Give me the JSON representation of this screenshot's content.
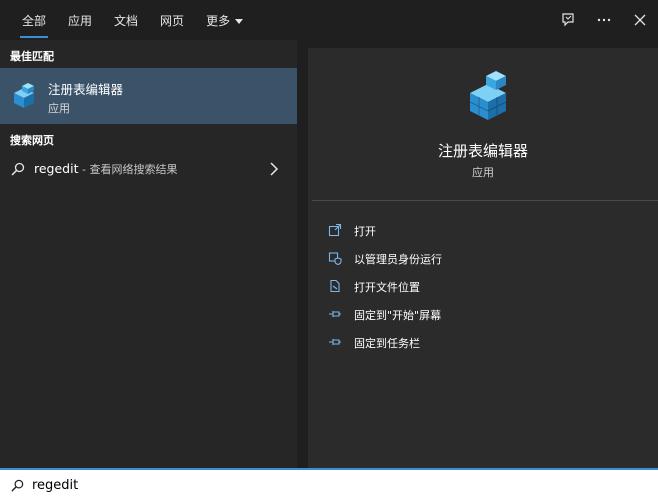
{
  "tabs": [
    {
      "label": "全部",
      "active": true
    },
    {
      "label": "应用"
    },
    {
      "label": "文档"
    },
    {
      "label": "网页"
    },
    {
      "label": "更多"
    }
  ],
  "top_icons": [
    "feedback-icon",
    "more-icon",
    "close-icon"
  ],
  "left": {
    "best_match_title": "最佳匹配",
    "best_match": {
      "name": "注册表编辑器",
      "type": "应用",
      "icon": "registry-editor-icon"
    },
    "web_title": "搜索网页",
    "web_item": {
      "query": "regedit",
      "hint": " - 查看网络搜索结果"
    }
  },
  "detail": {
    "name": "注册表编辑器",
    "type": "应用",
    "actions": [
      {
        "label": "打开",
        "icon": "open-icon"
      },
      {
        "label": "以管理员身份运行",
        "icon": "run-as-admin-icon"
      },
      {
        "label": "打开文件位置",
        "icon": "file-location-icon"
      },
      {
        "label": "固定到\"开始\"屏幕",
        "icon": "pin-icon"
      },
      {
        "label": "固定到任务栏",
        "icon": "pin-icon"
      }
    ]
  },
  "search": {
    "value": "regedit"
  },
  "colors": {
    "accent": "#3a8fd9",
    "selected": "#3b5369",
    "panel": "#2b2b2b",
    "left_panel": "#262626"
  }
}
